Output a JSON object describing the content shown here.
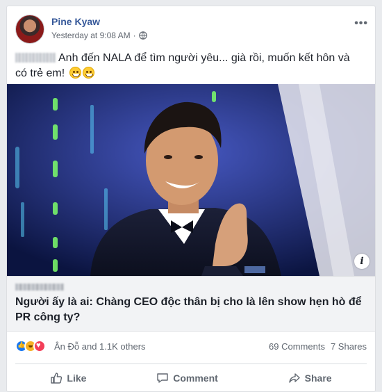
{
  "post": {
    "author": "Pine Kyaw",
    "timestamp": "Yesterday at 9:08 AM",
    "separator": "·",
    "privacy_icon": "globe-icon",
    "menu_icon": "more-options-icon",
    "text": "Anh đến NALA để tìm người yêu... già rồi, muốn kết hôn và có trẻ em!"
  },
  "link_preview": {
    "title": "Người ấy là ai: Chàng CEO độc thân bị cho là lên show hẹn hò để PR công ty?",
    "info_label": "i"
  },
  "reactions": {
    "names": "Ân Đỗ and 1.1K others",
    "comments": "69 Comments",
    "shares": "7 Shares"
  },
  "actions": {
    "like": "Like",
    "comment": "Comment",
    "share": "Share"
  },
  "colors": {
    "author_link": "#365899",
    "action_text": "#606770",
    "like_blue": "#1877f2"
  }
}
